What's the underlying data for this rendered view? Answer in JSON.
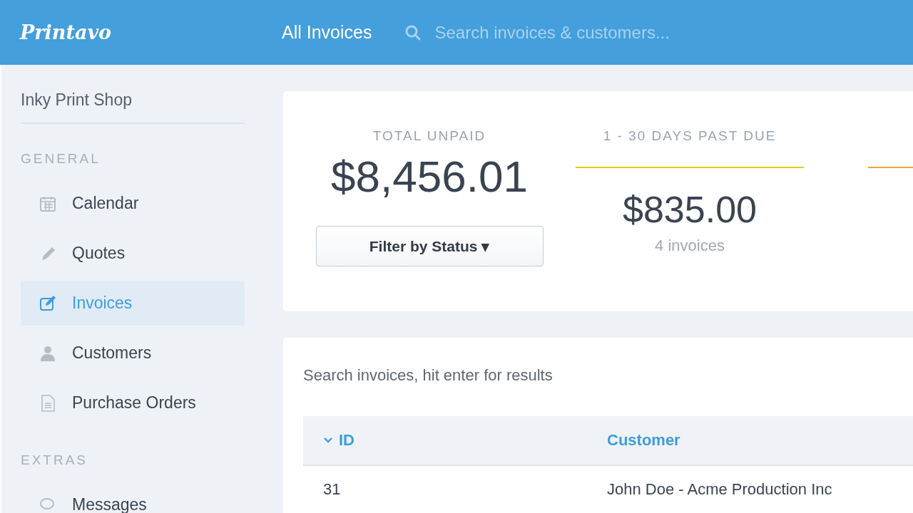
{
  "header": {
    "logo": "Printavo",
    "title": "All Invoices",
    "search": {
      "placeholder": "Search invoices & customers..."
    }
  },
  "sidebar": {
    "shop": "Inky Print Shop",
    "sections": [
      {
        "title": "GENERAL",
        "items": [
          {
            "label": "Calendar",
            "kind": "calendar",
            "selected": false
          },
          {
            "label": "Quotes",
            "kind": "quotes",
            "selected": false
          },
          {
            "label": "Invoices",
            "kind": "invoices",
            "selected": true
          },
          {
            "label": "Customers",
            "kind": "customers",
            "selected": false
          },
          {
            "label": "Purchase Orders",
            "kind": "orders",
            "selected": false
          }
        ]
      },
      {
        "title": "EXTRAS",
        "items": [
          {
            "label": "Messages",
            "kind": "messages",
            "selected": false
          }
        ]
      }
    ]
  },
  "summary": {
    "total": {
      "label": "TOTAL UNPAID",
      "amount": "$8,456.01",
      "filter_button": "Filter by Status ▾"
    },
    "buckets": [
      {
        "label": "1 - 30 DAYS PAST DUE",
        "color": "#e8c81c",
        "amount": "$835.00",
        "count": "4 invoices"
      },
      {
        "color": "#f2a23a"
      }
    ]
  },
  "invoices": {
    "search": {
      "placeholder": "Search invoices, hit enter for results"
    },
    "columns": [
      {
        "label": "ID",
        "sorted": true
      },
      {
        "label": "Customer",
        "sorted": false
      }
    ],
    "rows": [
      [
        "31",
        "John Doe - Acme Production Inc"
      ]
    ]
  }
}
